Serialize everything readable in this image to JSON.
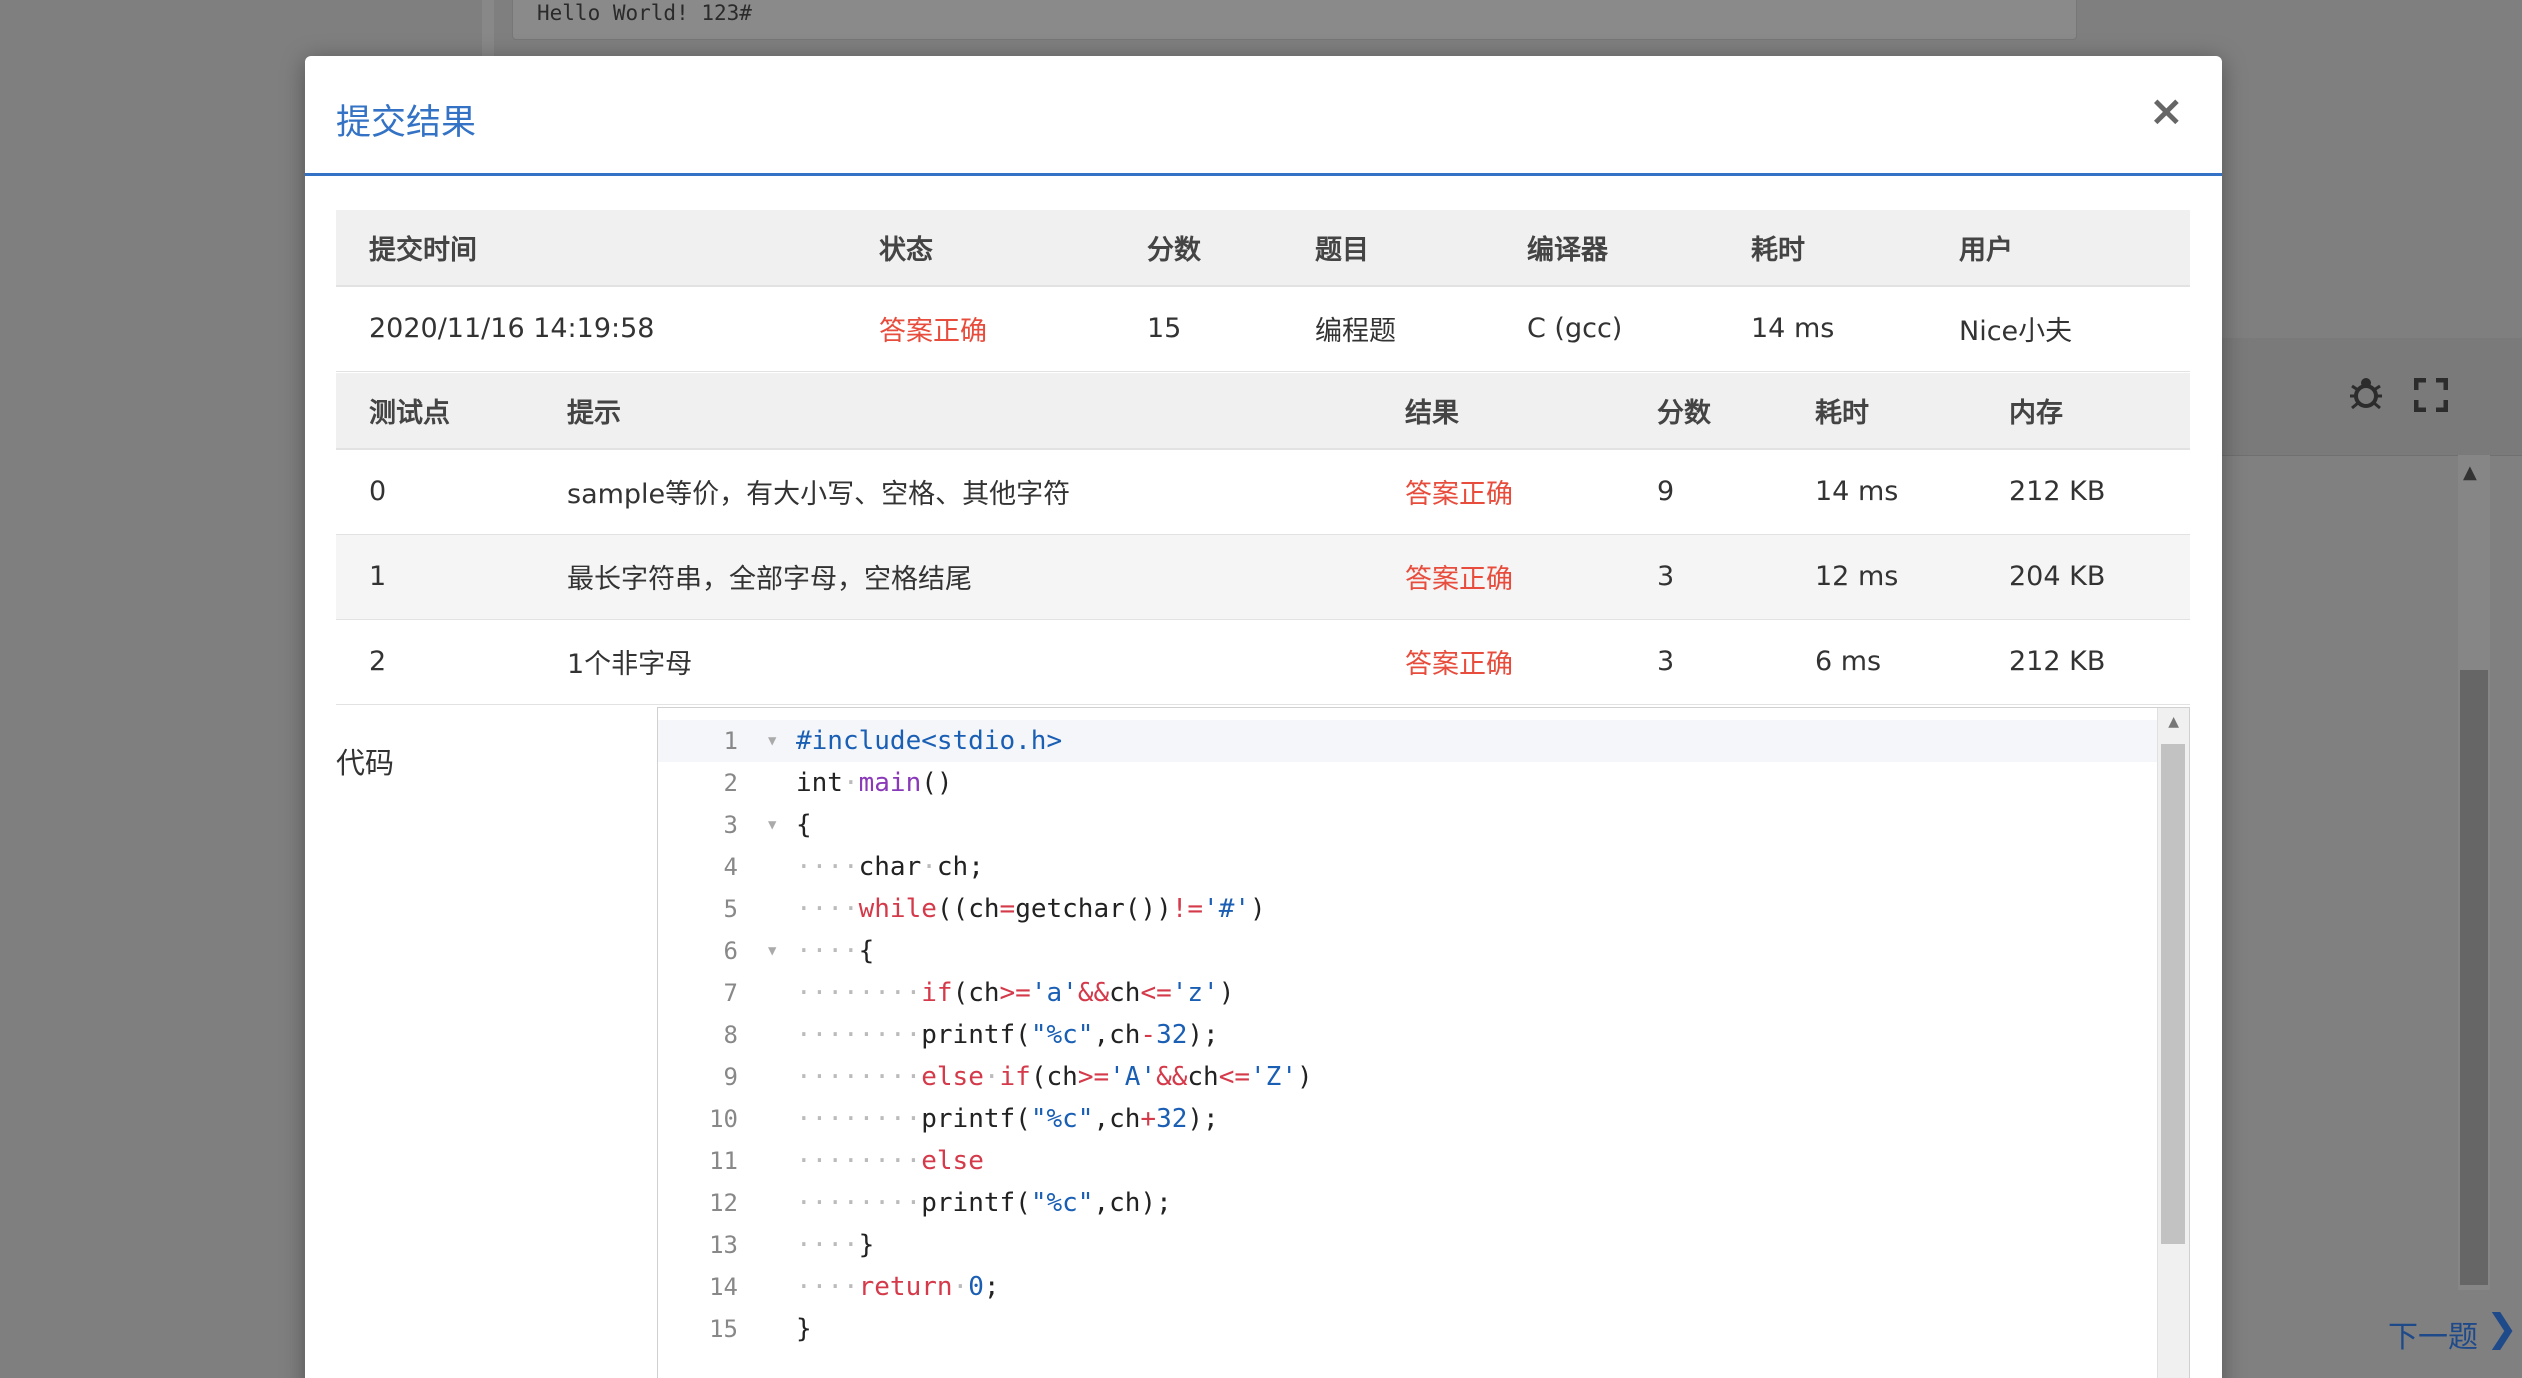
{
  "background": {
    "output_text": "Hello World! 123#",
    "next_label": "下一题",
    "icons": {
      "debug": "bug-icon",
      "fullscreen": "fullscreen-icon",
      "next": "chevron-right-icon"
    }
  },
  "modal": {
    "title": "提交结果",
    "close_label": "×",
    "summary": {
      "headers": [
        "提交时间",
        "状态",
        "分数",
        "题目",
        "编译器",
        "耗时",
        "用户"
      ],
      "row": {
        "time": "2020/11/16 14:19:58",
        "status": "答案正确",
        "score": "15",
        "problem": "编程题",
        "compiler": "C (gcc)",
        "elapsed": "14 ms",
        "user": "Nice小夫"
      }
    },
    "tests": {
      "headers": [
        "测试点",
        "提示",
        "结果",
        "分数",
        "耗时",
        "内存"
      ],
      "rows": [
        {
          "id": "0",
          "hint": "sample等价，有大小写、空格、其他字符",
          "result": "答案正确",
          "score": "9",
          "time": "14 ms",
          "memory": "212 KB"
        },
        {
          "id": "1",
          "hint": "最长字符串，全部字母，空格结尾",
          "result": "答案正确",
          "score": "3",
          "time": "12 ms",
          "memory": "204 KB"
        },
        {
          "id": "2",
          "hint": "1个非字母",
          "result": "答案正确",
          "score": "3",
          "time": "6 ms",
          "memory": "212 KB"
        }
      ]
    },
    "code_label": "代码",
    "code_lines": [
      "#include<stdio.h>",
      "int main()",
      "{",
      "    char ch;",
      "    while((ch=getchar())!='#')",
      "    {",
      "        if(ch>='a'&&ch<='z')",
      "        printf(\"%c\",ch-32);",
      "        else if(ch>='A'&&ch<='Z')",
      "        printf(\"%c\",ch+32);",
      "        else",
      "        printf(\"%c\",ch);",
      "    }",
      "    return 0;",
      "}"
    ],
    "line_numbers": [
      "1",
      "2",
      "3",
      "4",
      "5",
      "6",
      "7",
      "8",
      "9",
      "10",
      "11",
      "12",
      "13",
      "14",
      "15"
    ],
    "colors": {
      "accent": "#3372c4",
      "ok": "#e74c3c",
      "keyword": "#d43a4a",
      "string": "#1a5fb4",
      "number": "#1a5fb4",
      "func": "#8a3ab9"
    }
  }
}
